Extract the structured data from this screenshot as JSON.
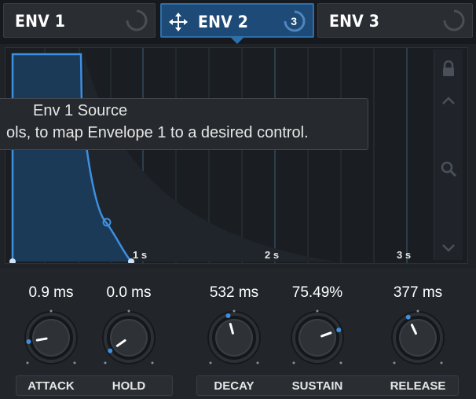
{
  "tabs": [
    {
      "label": "ENV 1",
      "active": false
    },
    {
      "label": "ENV 2",
      "active": true,
      "badge": "3"
    },
    {
      "label": "ENV 3",
      "active": false
    }
  ],
  "tooltip": {
    "title": "Env 1 Source",
    "body": "ols, to map Envelope 1 to a desired control."
  },
  "graph": {
    "time_labels": [
      "1 s",
      "2 s",
      "3 s"
    ],
    "side_icons": [
      "lock-icon",
      "chevron-up-icon",
      "zoom-icon",
      "chevron-down-icon"
    ],
    "curve_color": "#3d8fe0",
    "fill_color": "#1b3a57"
  },
  "knobs": [
    {
      "name": "attack",
      "label": "ATTACK",
      "value": "0.9 ms"
    },
    {
      "name": "hold",
      "label": "HOLD",
      "value": "0.0 ms"
    },
    {
      "name": "decay",
      "label": "DECAY",
      "value": "532 ms"
    },
    {
      "name": "sustain",
      "label": "SUSTAIN",
      "value": "75.49%"
    },
    {
      "name": "release",
      "label": "RELEASE",
      "value": "377 ms"
    }
  ],
  "colors": {
    "accent": "#2f6fa8",
    "indicator": "#3d8fe0"
  }
}
